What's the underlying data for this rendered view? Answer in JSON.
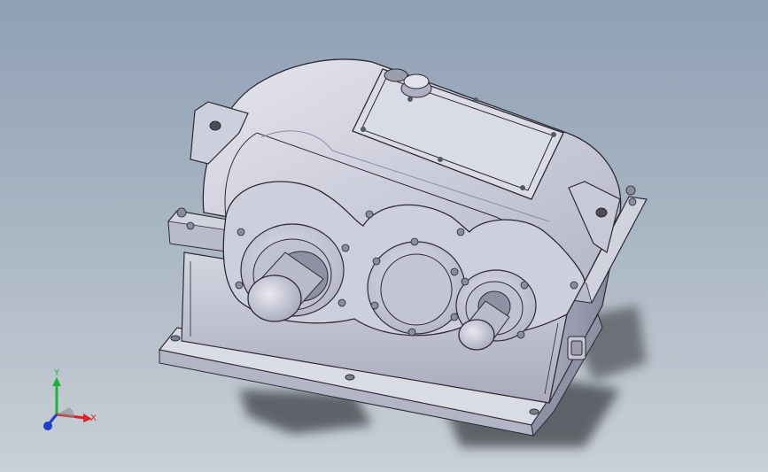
{
  "viewport": {
    "background_top": "#8fa0b4",
    "background_bottom": "#c9d0d6"
  },
  "model": {
    "part": "gearbox-reducer",
    "body_color": "#c7c9d6",
    "shade_color": "#9fa2b4",
    "edge_color": "#2b2b33"
  },
  "triad": {
    "x_label": "X",
    "y_label": "Y",
    "x_color": "#d8242a",
    "y_color": "#1db33a",
    "z_color": "#1f3fc6"
  }
}
